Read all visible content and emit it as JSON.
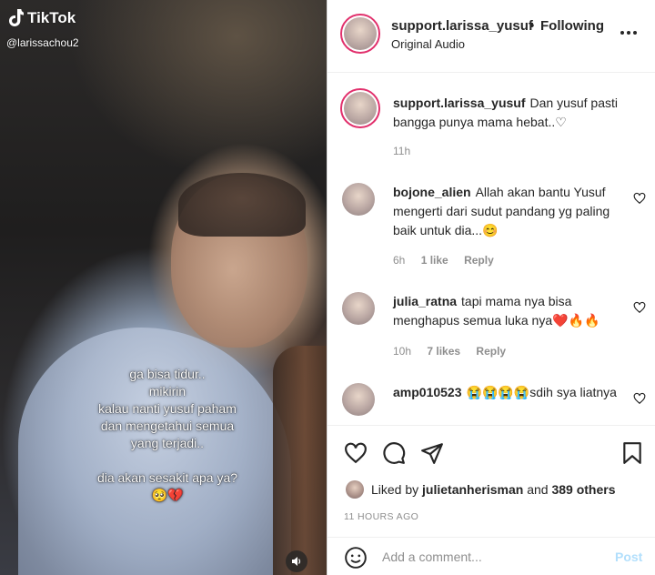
{
  "video": {
    "brand": "TikTok",
    "handle": "@larissachou2",
    "caption_lines": [
      "ga bisa tidur..",
      "mikirin",
      "kalau nanti yusuf paham",
      "dan mengetahui semua",
      "yang terjadi..",
      "",
      "dia akan sesakit apa ya?",
      "🥺💔"
    ],
    "volume_icon": "speaker-icon"
  },
  "post": {
    "header": {
      "username": "support.larissa_yusuf",
      "separator": "•",
      "follow_status": "Following",
      "audio": "Original Audio"
    },
    "caption": {
      "username": "support.larissa_yusuf",
      "text": "Dan yusuf pasti bangga punya mama hebat..♡",
      "time": "11h"
    },
    "comments": [
      {
        "username": "bojone_alien",
        "text": "Allah akan bantu Yusuf mengerti dari sudut pandang yg paling baik untuk dia...😊",
        "time": "6h",
        "likes": "1 like",
        "reply": "Reply"
      },
      {
        "username": "julia_ratna",
        "text": "tapi mama nya bisa menghapus semua luka nya❤️🔥🔥",
        "time": "10h",
        "likes": "7 likes",
        "reply": "Reply"
      },
      {
        "username": "amp010523",
        "text": "😭😭😭😭sdih sya liatnya",
        "time": "",
        "likes": "",
        "reply": ""
      }
    ],
    "liked_by": {
      "prefix": "Liked by",
      "user": "julietanherisman",
      "middle": "and",
      "others": "389 others"
    },
    "timestamp": "11 HOURS AGO",
    "add_comment_placeholder": "Add a comment...",
    "post_button": "Post"
  },
  "colors": {
    "text": "#262626",
    "muted": "#8e8e8e",
    "post_button_disabled": "#b2dffc",
    "story_ring": "#e1306c"
  }
}
